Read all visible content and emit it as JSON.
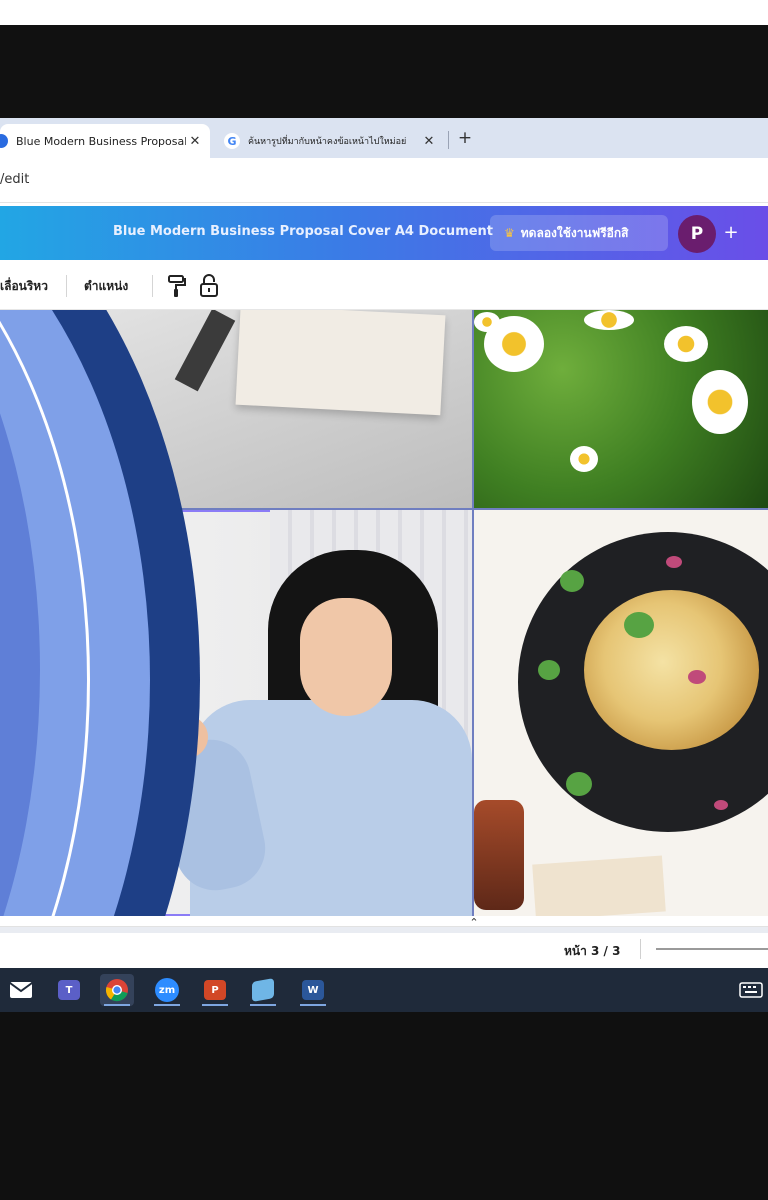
{
  "browser": {
    "tabs": [
      {
        "title": "Blue Modern Business Proposal",
        "icon": "canva-icon",
        "active": true
      },
      {
        "title": "ค้นหารูปที่มากับหน้าคงข้อเหน้าไปใหม่อย่",
        "icon": "google-icon",
        "active": false
      }
    ],
    "close_glyph": "✕",
    "new_tab_glyph": "+",
    "address": "/edit"
  },
  "canva": {
    "document_title": "Blue Modern Business Proposal Cover A4 Document",
    "trial_button": "ทดลองใช้งานฟรีอีกสิ",
    "crown_glyph": "♛",
    "avatar_initial": "P",
    "add_glyph": "+",
    "toolbar": {
      "animate_label": "เลื่อนริหว",
      "position_label": "ตำแหน่ง"
    },
    "status": {
      "page_label": "หน้า 3 / 3",
      "expand_glyph": "⌃"
    },
    "colors": {
      "header_start": "#22a6e4",
      "header_end": "#6a4ee8",
      "selection": "#8b7cf6",
      "avatar": "#6a1d6e"
    }
  },
  "taskbar": {
    "apps": [
      {
        "name": "mail-icon"
      },
      {
        "name": "teams-icon",
        "label": "T"
      },
      {
        "name": "chrome-icon",
        "active": true
      },
      {
        "name": "zoom-icon",
        "label": "zm"
      },
      {
        "name": "powerpoint-icon",
        "label": "P"
      },
      {
        "name": "notepad-icon"
      },
      {
        "name": "word-icon",
        "label": "W"
      }
    ]
  }
}
